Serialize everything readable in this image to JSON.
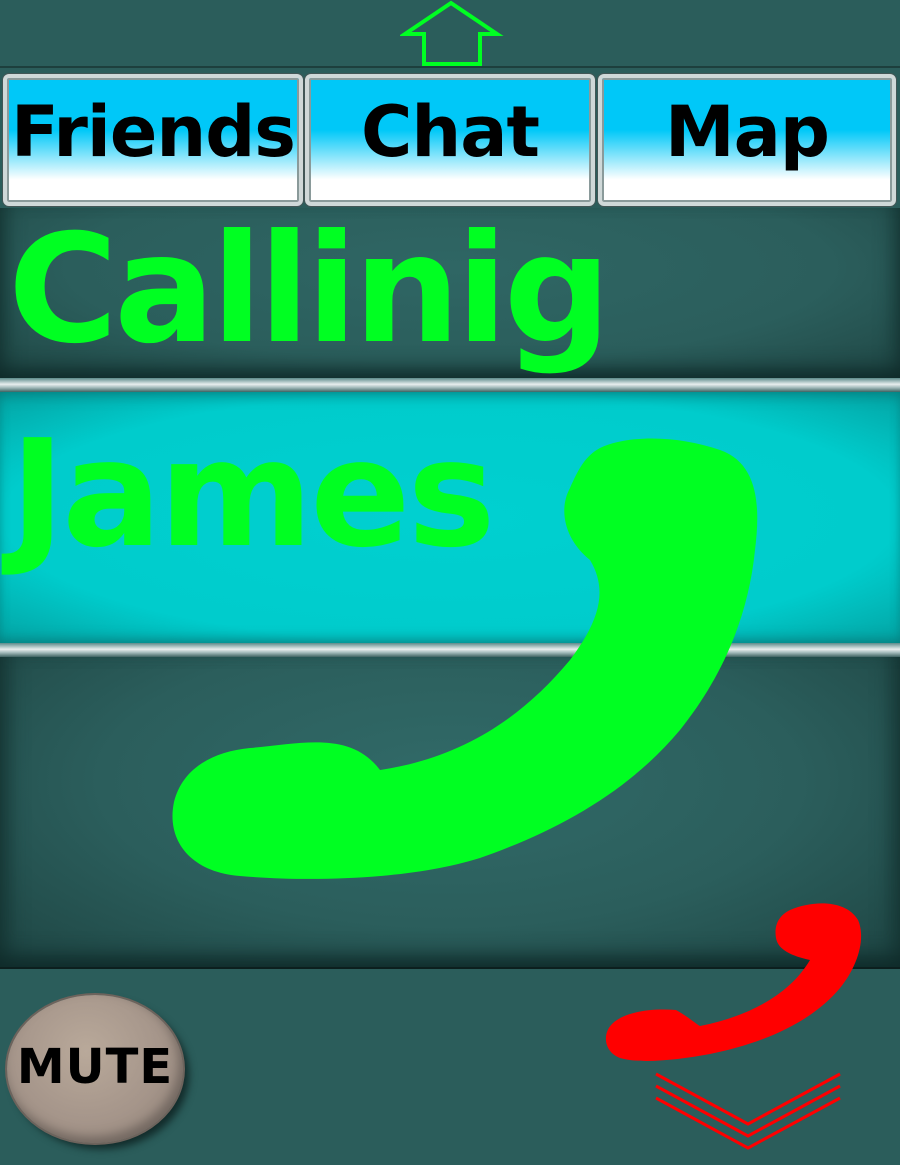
{
  "tabs": [
    {
      "label": "Friends"
    },
    {
      "label": "Chat"
    },
    {
      "label": "Map"
    }
  ],
  "call": {
    "status": "Callinig",
    "caller_name": "James"
  },
  "controls": {
    "mute_label": "MUTE"
  },
  "icons": {
    "home": "home-arrow-up-icon",
    "answer": "phone-handset-icon",
    "hangup": "phone-hangup-icon",
    "collapse": "double-chevron-down-icon"
  },
  "colors": {
    "background": "#2b5d5b",
    "accent_green": "#00ff22",
    "tab_blue": "#00c8f8",
    "caller_panel": "#00cccc",
    "hangup_red": "#ff0000",
    "mute_button": "#a5958a"
  }
}
